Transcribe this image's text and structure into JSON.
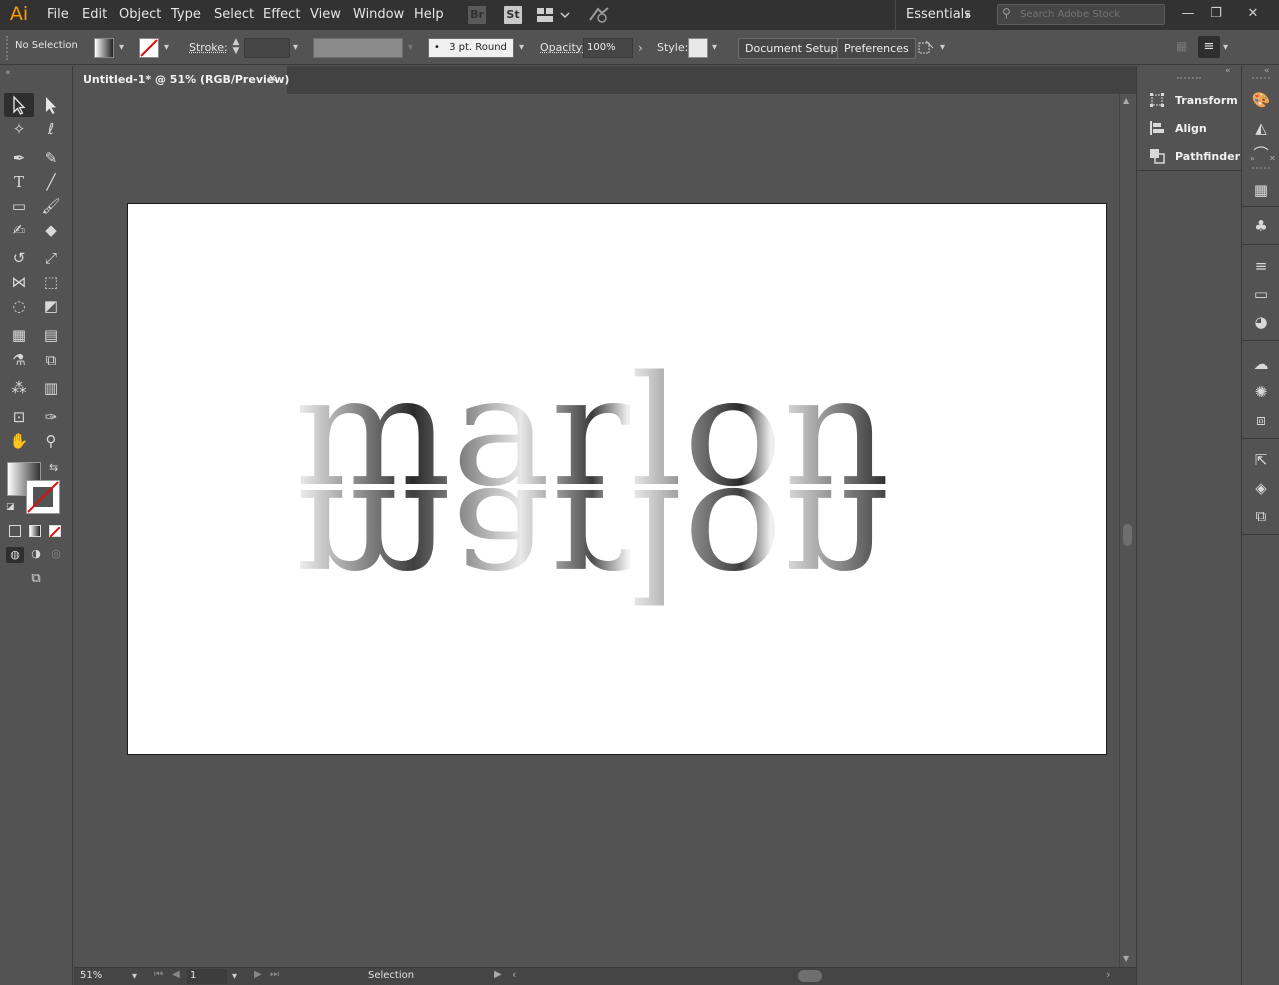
{
  "app": {
    "logo": "Ai"
  },
  "menu": [
    "File",
    "Edit",
    "Object",
    "Type",
    "Select",
    "Effect",
    "View",
    "Window",
    "Help"
  ],
  "menubar": {
    "bridge_label": "Br",
    "stock_label": "St",
    "workspace": "Essentials",
    "search_placeholder": "Search Adobe Stock"
  },
  "control": {
    "selection_state": "No Selection",
    "stroke_label": "Stroke:",
    "brush": "3 pt. Round",
    "opacity_label": "Opacity:",
    "opacity_value": "100%",
    "style_label": "Style:",
    "document_setup": "Document Setup",
    "preferences": "Preferences"
  },
  "document": {
    "tab_title": "Untitled-1* @ 51% (RGB/Preview)",
    "artwork_text": "marlon"
  },
  "status": {
    "zoom": "51%",
    "artboard_number": "1",
    "tool_name": "Selection"
  },
  "panels": [
    {
      "label": "Transform",
      "icon": "transform-icon"
    },
    {
      "label": "Align",
      "icon": "align-icon"
    },
    {
      "label": "Pathfinder",
      "icon": "pathfinder-icon"
    }
  ],
  "colors": {
    "ui_dark": "#323232",
    "ui_mid": "#535353",
    "accent_logo": "#ff9a00"
  }
}
